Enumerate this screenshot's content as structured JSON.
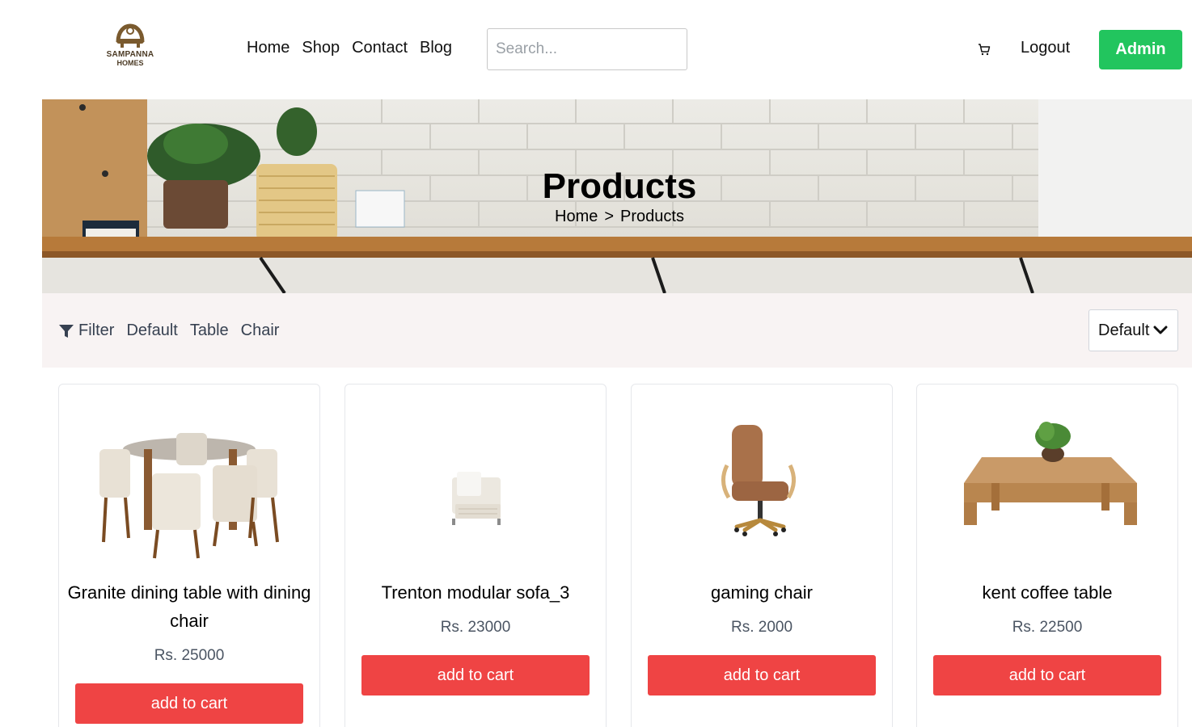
{
  "logo": {
    "line1": "SAMPANNA",
    "line2": "HOMES"
  },
  "nav": {
    "home": "Home",
    "shop": "Shop",
    "contact": "Contact",
    "blog": "Blog"
  },
  "search": {
    "placeholder": "Search...",
    "value": ""
  },
  "header": {
    "cart_icon": "cart-icon",
    "logout": "Logout",
    "admin": "Admin"
  },
  "hero": {
    "title": "Products",
    "crumb_home": "Home",
    "crumb_sep": ">",
    "crumb_current": "Products"
  },
  "filters": {
    "filter_label": "Filter",
    "default": "Default",
    "table": "Table",
    "chair": "Chair",
    "filter_icon": "funnel-icon"
  },
  "sort": {
    "selected": "Default",
    "icon": "chevron-down-icon"
  },
  "products": [
    {
      "name": "Granite dining table with dining chair",
      "price": "Rs. 25000",
      "button": "add to cart"
    },
    {
      "name": "Trenton modular sofa_3",
      "price": "Rs. 23000",
      "button": "add to cart"
    },
    {
      "name": "gaming chair",
      "price": "Rs. 2000",
      "button": "add to cart"
    },
    {
      "name": "kent coffee table",
      "price": "Rs. 22500",
      "button": "add to cart"
    }
  ],
  "colors": {
    "admin": "#22c55e",
    "add_to_cart": "#ef4444",
    "filterbar_bg": "#f8f3f3"
  }
}
